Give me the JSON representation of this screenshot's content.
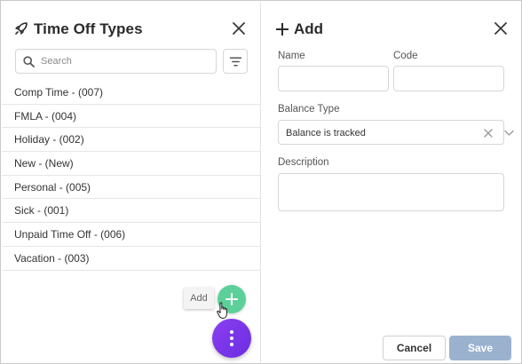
{
  "left_panel": {
    "title": "Time Off Types",
    "search_placeholder": "Search",
    "items": [
      {
        "label": "Comp Time - (007)"
      },
      {
        "label": "FMLA - (004)"
      },
      {
        "label": "Holiday - (002)"
      },
      {
        "label": "New - (New)"
      },
      {
        "label": "Personal - (005)"
      },
      {
        "label": "Sick - (001)"
      },
      {
        "label": "Unpaid Time Off - (006)"
      },
      {
        "label": "Vacation - (003)"
      }
    ],
    "tooltip": "Add"
  },
  "right_panel": {
    "title": "Add",
    "name_label": "Name",
    "name_value": "",
    "code_label": "Code",
    "code_value": "",
    "balance_type_label": "Balance Type",
    "balance_type_value": "Balance is tracked",
    "description_label": "Description",
    "description_value": "",
    "cancel_label": "Cancel",
    "save_label": "Save"
  },
  "icons": {
    "title": "rocket-icon",
    "close": "close-icon",
    "search": "search-icon",
    "filter": "filter-icon",
    "add": "plus-icon",
    "menu": "vertical-dots-icon",
    "cursor": "hand-pointer-icon",
    "clear": "clear-icon",
    "caret": "chevron-down-icon"
  },
  "colors": {
    "add_fab": "#5dd09a",
    "menu_fab": "#7a35ea",
    "save_button": "#9bb2cf"
  }
}
